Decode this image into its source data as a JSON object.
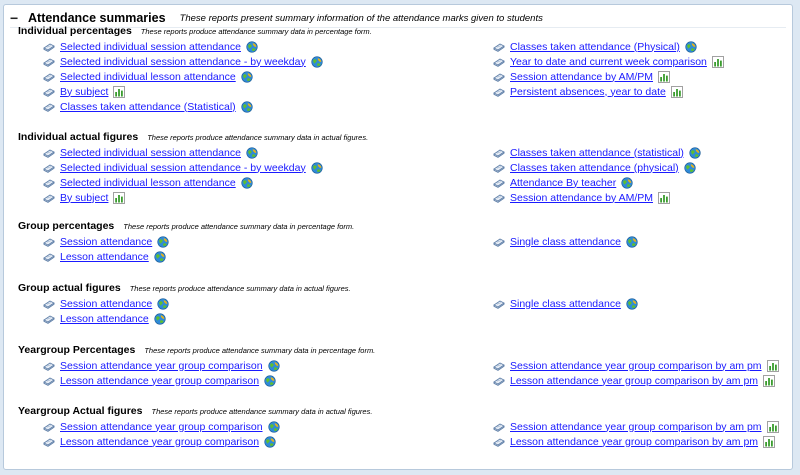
{
  "header": {
    "title": "Attendance summaries",
    "description": "These reports present summary information of the attendance marks given to students"
  },
  "sections": [
    {
      "title": "Individual percentages",
      "description": "These reports produce attendance summary data in percentage form.",
      "left": [
        {
          "label": "Selected individual session attendance",
          "icon": "globe-icon"
        },
        {
          "label": "Selected individual session attendance - by weekday",
          "icon": "globe-icon"
        },
        {
          "label": "Selected individual lesson attendance",
          "icon": "globe-icon"
        },
        {
          "label": "By subject",
          "icon": "bar-chart-icon"
        },
        {
          "label": "Classes taken attendance (Statistical)",
          "icon": "globe-icon"
        }
      ],
      "right": [
        {
          "label": "Classes taken attendance (Physical)",
          "icon": "globe-icon"
        },
        {
          "label": "Year to date and current week comparison",
          "icon": "bar-chart-icon"
        },
        {
          "label": "Session attendance by AM/PM",
          "icon": "bar-chart-icon"
        },
        {
          "label": "Persistent absences, year to date",
          "icon": "bar-chart-icon"
        }
      ]
    },
    {
      "title": "Individual actual figures",
      "description": "These reports produce attendance summary data in actual figures.",
      "left": [
        {
          "label": "Selected individual session attendance",
          "icon": "globe-icon"
        },
        {
          "label": "Selected individual session attendance - by weekday",
          "icon": "globe-icon"
        },
        {
          "label": "Selected individual lesson attendance",
          "icon": "globe-icon"
        },
        {
          "label": "By subject",
          "icon": "bar-chart-icon"
        }
      ],
      "right": [
        {
          "label": "Classes taken attendance (statistical)",
          "icon": "globe-icon"
        },
        {
          "label": "Classes taken attendance (physical)",
          "icon": "globe-icon"
        },
        {
          "label": "Attendance By teacher",
          "icon": "globe-icon"
        },
        {
          "label": "Session attendance by AM/PM",
          "icon": "bar-chart-icon"
        }
      ]
    },
    {
      "title": "Group percentages",
      "description": "These reports produce attendance summary data in percentage form.",
      "left": [
        {
          "label": "Session attendance",
          "icon": "globe-icon"
        },
        {
          "label": "Lesson attendance",
          "icon": "globe-icon"
        }
      ],
      "right": [
        {
          "label": "Single class attendance",
          "icon": "globe-icon"
        }
      ]
    },
    {
      "title": "Group actual figures",
      "description": "These reports produce attendance summary data in actual figures.",
      "left": [
        {
          "label": "Session attendance",
          "icon": "globe-icon"
        },
        {
          "label": "Lesson attendance",
          "icon": "globe-icon"
        }
      ],
      "right": [
        {
          "label": "Single class attendance",
          "icon": "globe-icon"
        }
      ]
    },
    {
      "title": "Yeargroup Percentages",
      "description": "These reports produce attendance summary data in percentage form.",
      "left": [
        {
          "label": "Session attendance year group comparison",
          "icon": "globe-icon"
        },
        {
          "label": "Lesson attendance year group comparison",
          "icon": "globe-icon"
        }
      ],
      "right": [
        {
          "label": "Session attendance year group comparison by am pm",
          "icon": "bar-chart-icon"
        },
        {
          "label": "Lesson attendance year group comparison by am pm",
          "icon": "bar-chart-icon"
        }
      ]
    },
    {
      "title": "Yeargroup Actual figures",
      "description": "These reports produce attendance summary data in actual figures.",
      "left": [
        {
          "label": "Session attendance year group comparison",
          "icon": "globe-icon"
        },
        {
          "label": "Lesson attendance year group comparison",
          "icon": "globe-icon"
        }
      ],
      "right": [
        {
          "label": "Session attendance year group comparison by am pm",
          "icon": "bar-chart-icon"
        },
        {
          "label": "Lesson attendance year group comparison by am pm",
          "icon": "bar-chart-icon"
        }
      ]
    }
  ]
}
